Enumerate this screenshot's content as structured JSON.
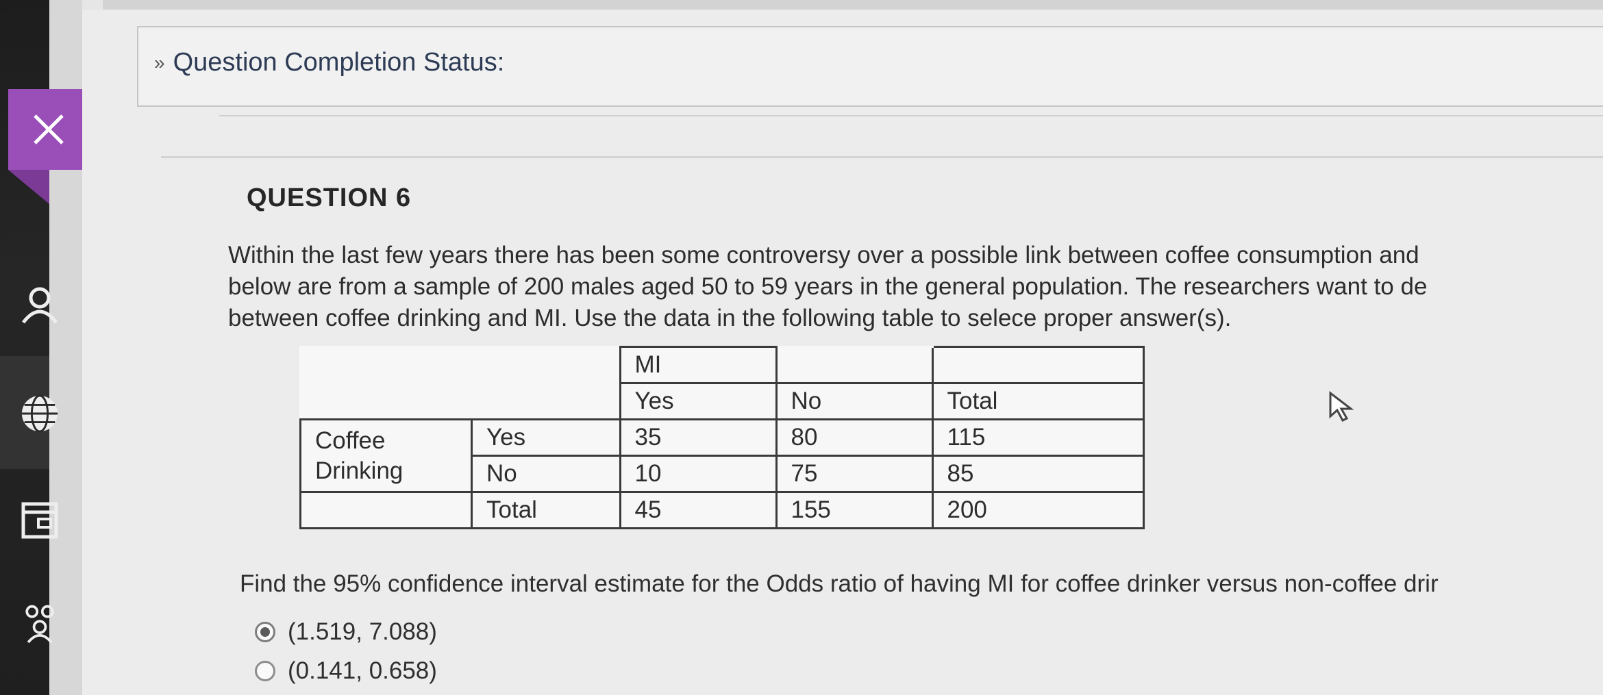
{
  "header": {
    "completion_status_label": "Question Completion Status:"
  },
  "question": {
    "title": "QUESTION 6",
    "lines": [
      "Within the last few years there has been some controversy over a possible link between coffee consumption and",
      "below are from a sample of 200 males aged 50 to 59 years in the general population. The researchers want to de",
      "between coffee drinking and MI. Use the data in the following table to selece proper answer(s)."
    ]
  },
  "table": {
    "group_header": "MI",
    "col_headers": [
      "Yes",
      "No",
      "Total"
    ],
    "row_group_label_line1": "Coffee",
    "row_group_label_line2": "Drinking",
    "rows": [
      {
        "label": "Yes",
        "cells": [
          "35",
          "80",
          "115"
        ]
      },
      {
        "label": "No",
        "cells": [
          "10",
          "75",
          "85"
        ]
      },
      {
        "label": "Total",
        "cells": [
          "45",
          "155",
          "200"
        ]
      }
    ]
  },
  "prompt": "Find the 95% confidence interval estimate for the Odds ratio of having MI for coffee drinker versus non-coffee drir",
  "options": [
    {
      "label": "(1.519, 7.088)",
      "selected": true
    },
    {
      "label": "(0.141, 0.658)",
      "selected": false
    }
  ],
  "colors": {
    "accent_close": "#9a4fb8",
    "rail": "#1d1d1d"
  },
  "icons": {
    "close": "close-icon",
    "user": "user-icon",
    "globe": "globe-icon",
    "calendar": "calendar-icon",
    "group": "group-icon",
    "chevron": "chevron-down-icon",
    "cursor": "mouse-cursor-icon"
  }
}
